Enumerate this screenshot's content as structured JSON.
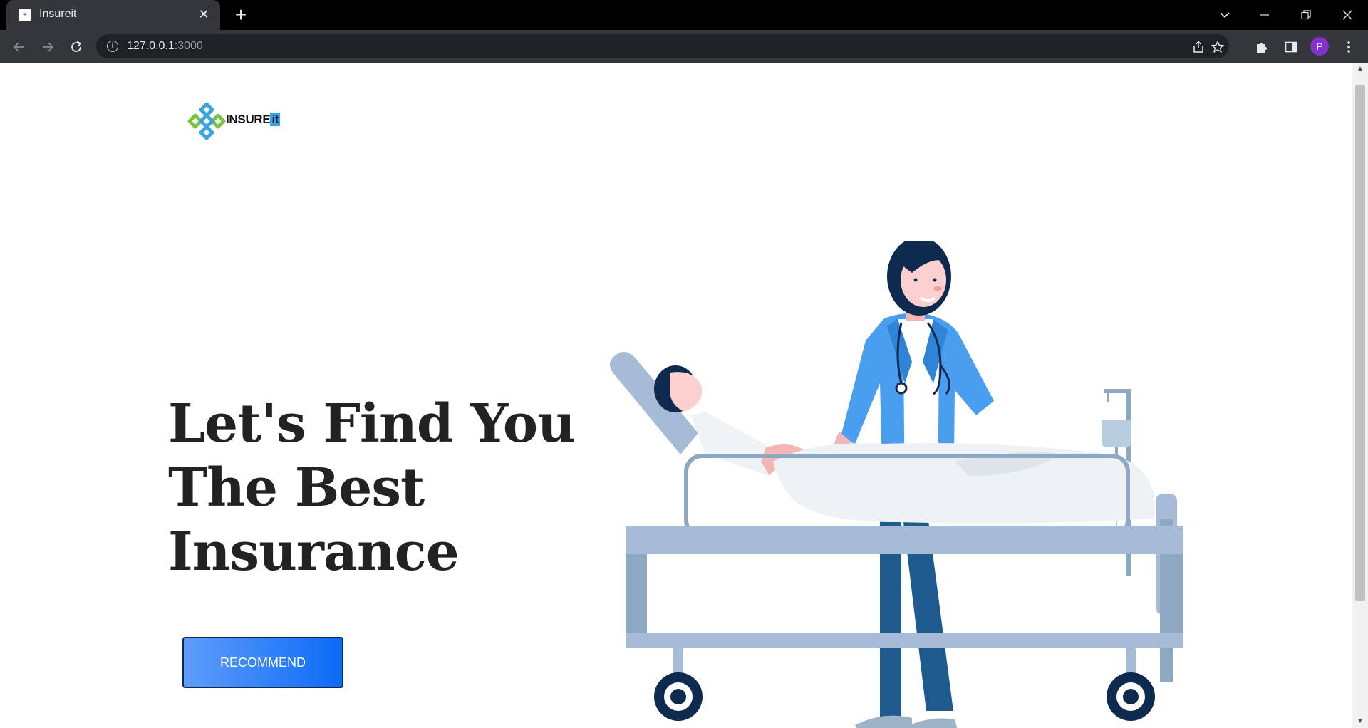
{
  "browser": {
    "tab_title": "Insureit",
    "favicon_glyph": "+",
    "tab_close": "✕",
    "new_tab": "+",
    "url_host": "127.0.0.1",
    "url_port": ":3000",
    "profile_initial": "P",
    "icons": {
      "back": "arrow-left-icon",
      "forward": "arrow-right-icon",
      "reload": "reload-icon",
      "info": "info-icon",
      "share": "share-icon",
      "bookmark": "star-icon",
      "extensions": "puzzle-icon",
      "side_panel": "side-panel-icon",
      "menu": "kebab-menu-icon",
      "tab_search": "chevron-down-icon",
      "minimize": "minimize-icon",
      "restore": "restore-icon",
      "close": "close-icon"
    }
  },
  "page": {
    "logo_text_main": "INSURE",
    "logo_text_accent": "it",
    "hero_title_lines": [
      "Let's Find You",
      "The Best",
      "Insurance"
    ],
    "cta_label": "RECOMMEND"
  },
  "colors": {
    "accent": "#0b6bf5",
    "accent_light": "#5f9dfb",
    "heading": "#222222",
    "logo_green": "#7dc242",
    "logo_blue": "#3aa5e0"
  }
}
